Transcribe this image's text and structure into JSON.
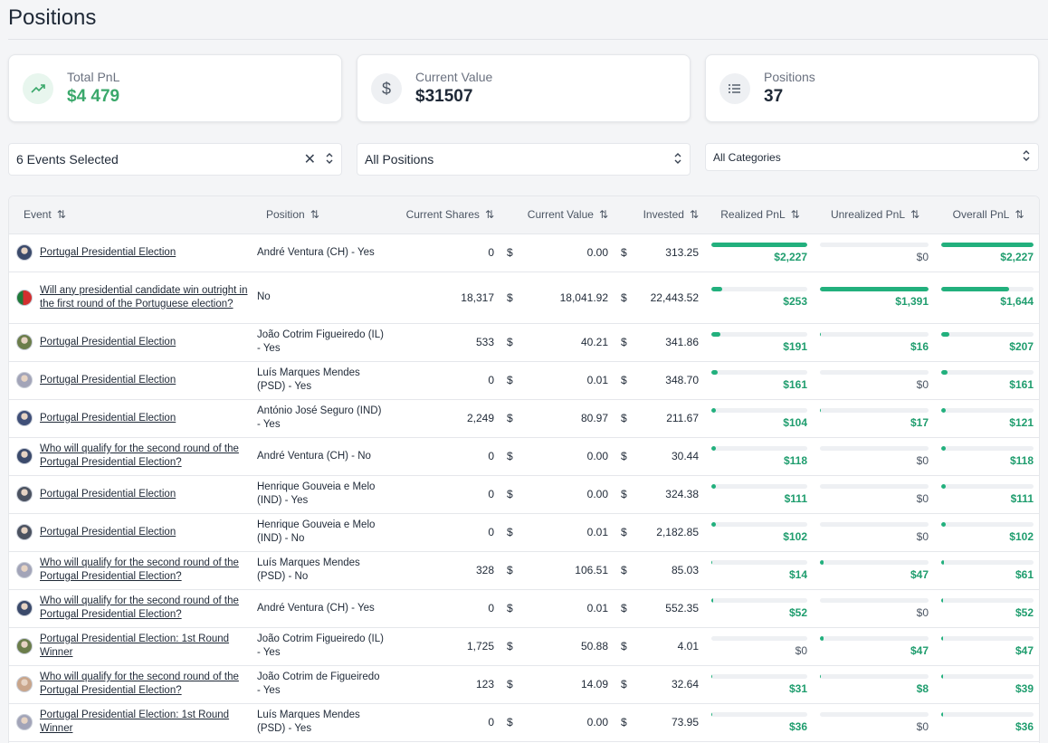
{
  "page": {
    "title": "Positions"
  },
  "summary": [
    {
      "label": "Total PnL",
      "value": "$4 479",
      "icon": "trending-up-icon",
      "color": "#3aa86b"
    },
    {
      "label": "Current Value",
      "value": "$31507",
      "icon": "dollar-icon",
      "color": "#1f2937"
    },
    {
      "label": "Positions",
      "value": "37",
      "icon": "list-icon",
      "color": "#1f2937"
    }
  ],
  "filters": {
    "events": "6 Events Selected",
    "positions": "All Positions",
    "categories": "All Categories"
  },
  "columns": {
    "event": "Event",
    "position": "Position",
    "shares": "Current Shares",
    "value": "Current Value",
    "invested": "Invested",
    "realized": "Realized PnL",
    "unrealized": "Unrealized PnL",
    "overall": "Overall PnL"
  },
  "accent": "#22b07d",
  "rows": [
    {
      "event": "Portugal Presidential Election",
      "position": "André Ventura (CH) - Yes",
      "shares": "0",
      "value": "0.00",
      "invested": "313.25",
      "realized": "$2,227",
      "realized_pct": 1.0,
      "unrealized": "$0",
      "unrealized_pct": 0,
      "overall": "$2,227",
      "overall_pct": 1.0,
      "avatar": "#3b4a6b"
    },
    {
      "event": "Will any presidential candidate win outright in the first round of the Portuguese election?",
      "position": "No",
      "shares": "18,317",
      "value": "18,041.92",
      "invested": "22,443.52",
      "realized": "$253",
      "realized_pct": 0.11,
      "unrealized": "$1,391",
      "unrealized_pct": 1.0,
      "overall": "$1,644",
      "overall_pct": 0.74,
      "avatar": "flag"
    },
    {
      "event": "Portugal Presidential Election",
      "position": "João Cotrim Figueiredo (IL) - Yes",
      "shares": "533",
      "value": "40.21",
      "invested": "341.86",
      "realized": "$191",
      "realized_pct": 0.09,
      "unrealized": "$16",
      "unrealized_pct": 0.01,
      "overall": "$207",
      "overall_pct": 0.09,
      "avatar": "#6b7d4a"
    },
    {
      "event": "Portugal Presidential Election",
      "position": "Luís Marques Mendes (PSD) - Yes",
      "shares": "0",
      "value": "0.01",
      "invested": "348.70",
      "realized": "$161",
      "realized_pct": 0.07,
      "unrealized": "$0",
      "unrealized_pct": 0,
      "overall": "$161",
      "overall_pct": 0.07,
      "avatar": "#a2a4b8"
    },
    {
      "event": "Portugal Presidential Election",
      "position": "António José Seguro (IND) - Yes",
      "shares": "2,249",
      "value": "80.97",
      "invested": "211.67",
      "realized": "$104",
      "realized_pct": 0.05,
      "unrealized": "$17",
      "unrealized_pct": 0.01,
      "overall": "$121",
      "overall_pct": 0.05,
      "avatar": "#3f4f78"
    },
    {
      "event": "Who will qualify for the second round of the Portugal Presidential Election?",
      "position": "André Ventura (CH) - No",
      "shares": "0",
      "value": "0.00",
      "invested": "30.44",
      "realized": "$118",
      "realized_pct": 0.05,
      "unrealized": "$0",
      "unrealized_pct": 0,
      "overall": "$118",
      "overall_pct": 0.05,
      "avatar": "#3b4a6b"
    },
    {
      "event": "Portugal Presidential Election",
      "position": "Henrique Gouveia e Melo (IND) - Yes",
      "shares": "0",
      "value": "0.00",
      "invested": "324.38",
      "realized": "$111",
      "realized_pct": 0.05,
      "unrealized": "$0",
      "unrealized_pct": 0,
      "overall": "$111",
      "overall_pct": 0.05,
      "avatar": "#4b5260"
    },
    {
      "event": "Portugal Presidential Election",
      "position": "Henrique Gouveia e Melo (IND) - No",
      "shares": "0",
      "value": "0.01",
      "invested": "2,182.85",
      "realized": "$102",
      "realized_pct": 0.05,
      "unrealized": "$0",
      "unrealized_pct": 0,
      "overall": "$102",
      "overall_pct": 0.05,
      "avatar": "#4b5260"
    },
    {
      "event": "Who will qualify for the second round of the Portugal Presidential Election?",
      "position": "Luís Marques Mendes (PSD) - No",
      "shares": "328",
      "value": "106.51",
      "invested": "85.03",
      "realized": "$14",
      "realized_pct": 0.01,
      "unrealized": "$47",
      "unrealized_pct": 0.03,
      "overall": "$61",
      "overall_pct": 0.03,
      "avatar": "#a2a4b8"
    },
    {
      "event": "Who will qualify for the second round of the Portugal Presidential Election?",
      "position": "André Ventura (CH) - Yes",
      "shares": "0",
      "value": "0.01",
      "invested": "552.35",
      "realized": "$52",
      "realized_pct": 0.02,
      "unrealized": "$0",
      "unrealized_pct": 0,
      "overall": "$52",
      "overall_pct": 0.02,
      "avatar": "#3b4a6b"
    },
    {
      "event": "Portugal Presidential Election: 1st Round Winner",
      "position": "João Cotrim Figueiredo (IL) - Yes",
      "shares": "1,725",
      "value": "50.88",
      "invested": "4.01",
      "realized": "$0",
      "realized_pct": 0,
      "unrealized": "$47",
      "unrealized_pct": 0.03,
      "overall": "$47",
      "overall_pct": 0.02,
      "avatar": "#6b7d4a"
    },
    {
      "event": "Who will qualify for the second round of the Portugal Presidential Election?",
      "position": "João Cotrim de Figueiredo - Yes",
      "shares": "123",
      "value": "14.09",
      "invested": "32.64",
      "realized": "$31",
      "realized_pct": 0.01,
      "unrealized": "$8",
      "unrealized_pct": 0.01,
      "overall": "$39",
      "overall_pct": 0.02,
      "avatar": "#c9a58a"
    },
    {
      "event": "Portugal Presidential Election: 1st Round Winner",
      "position": "Luís Marques Mendes (PSD) - Yes",
      "shares": "0",
      "value": "0.00",
      "invested": "73.95",
      "realized": "$36",
      "realized_pct": 0.01,
      "unrealized": "$0",
      "unrealized_pct": 0,
      "overall": "$36",
      "overall_pct": 0.02,
      "avatar": "#a2a4b8"
    }
  ]
}
